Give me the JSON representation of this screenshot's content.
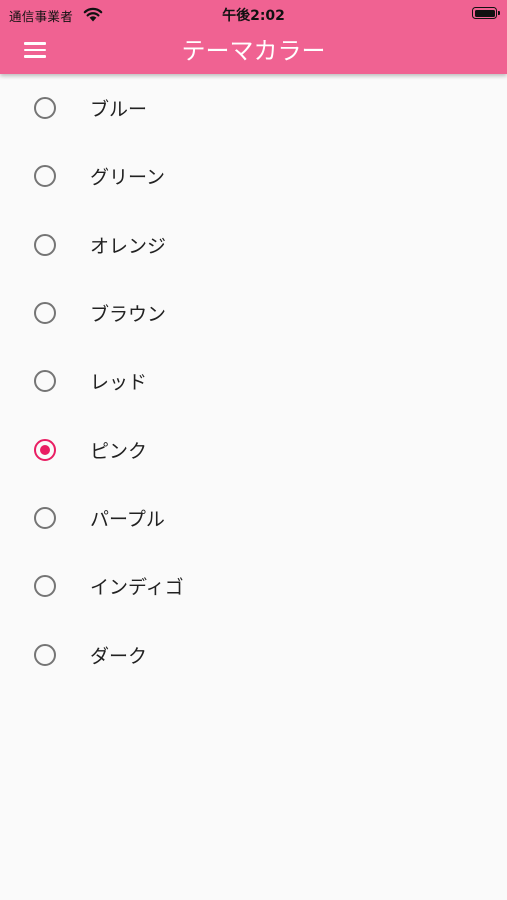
{
  "status_bar": {
    "carrier": "通信事業者",
    "time": "午後2:02",
    "wifi_icon": "wifi-icon",
    "battery_icon": "battery-icon"
  },
  "app_bar": {
    "title": "テーマカラー",
    "menu_icon": "menu-icon",
    "background_color": "#f06292"
  },
  "theme_options": {
    "selected": "ピンク",
    "accent_color": "#e91e63",
    "items": [
      {
        "label": "ブルー",
        "selected": false
      },
      {
        "label": "グリーン",
        "selected": false
      },
      {
        "label": "オレンジ",
        "selected": false
      },
      {
        "label": "ブラウン",
        "selected": false
      },
      {
        "label": "レッド",
        "selected": false
      },
      {
        "label": "ピンク",
        "selected": true
      },
      {
        "label": "パープル",
        "selected": false
      },
      {
        "label": "インディゴ",
        "selected": false
      },
      {
        "label": "ダーク",
        "selected": false
      }
    ]
  }
}
